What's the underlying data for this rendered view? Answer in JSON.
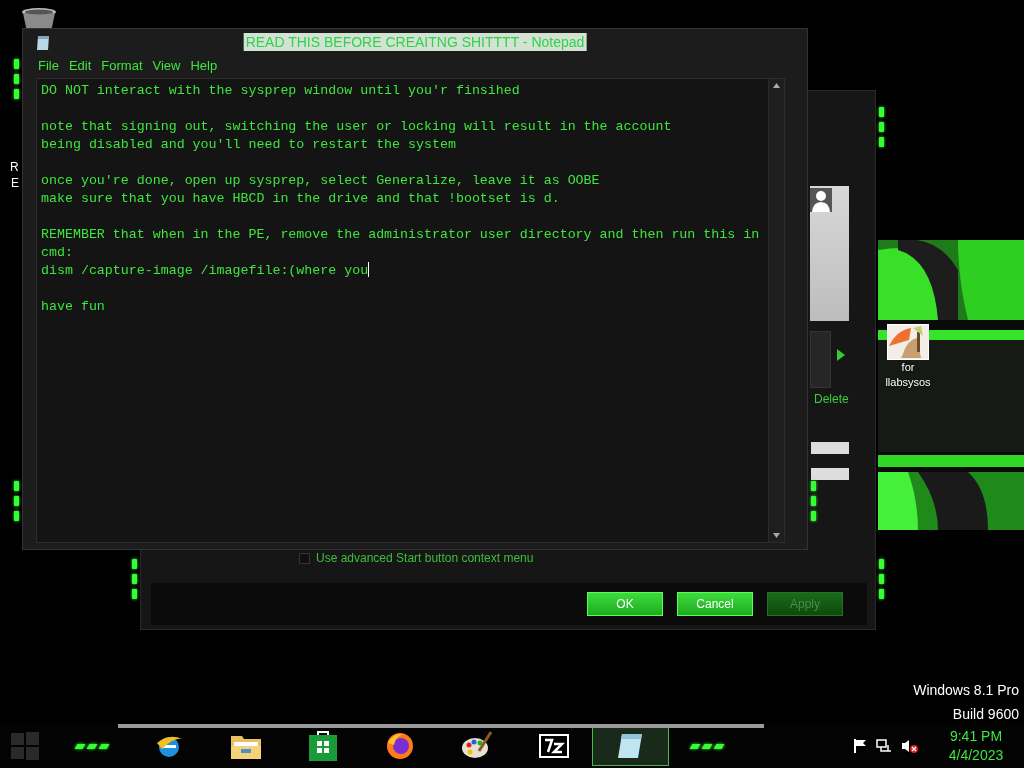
{
  "desktop": {
    "edge_letters": [
      "R",
      "E"
    ],
    "icons": [
      {
        "label_lines": [
          "for",
          "llabsysos"
        ]
      }
    ],
    "watermark": [
      "Windows 8.1 Pro",
      "Build 9600"
    ]
  },
  "properties_dialog": {
    "link": "Delete",
    "checkbox": {
      "label": "Use advanced Start button context menu",
      "checked": false
    },
    "buttons": [
      {
        "label": "OK",
        "disabled": false
      },
      {
        "label": "Cancel",
        "disabled": false
      },
      {
        "label": "Apply",
        "disabled": true
      }
    ]
  },
  "notepad": {
    "title": "READ THIS BEFORE CREAITNG SHITTTT - Notepad",
    "menu": [
      "File",
      "Edit",
      "Format",
      "View",
      "Help"
    ],
    "paragraphs": [
      [
        "DO NOT interact with the sysprep window until you'r finsihed"
      ],
      [
        "note that signing out, switching the user or locking will result in the account",
        "being disabled and you'll need to restart the system"
      ],
      [
        "once you're done, open up sysprep, select Generalize, leave it as OOBE",
        "make sure that you have HBCD in the drive and that !bootset is d."
      ],
      [
        "REMEMBER that when in the PE, remove the administrator user directory and then run this in",
        "cmd:",
        "dism /capture-image /imagefile:(where you"
      ],
      [
        "have fun"
      ]
    ]
  },
  "taskbar": {
    "apps": [
      {
        "kind": "globe",
        "selected": false
      },
      {
        "kind": "folder",
        "selected": false
      },
      {
        "kind": "store",
        "selected": false
      },
      {
        "kind": "browser",
        "selected": false
      },
      {
        "kind": "palette",
        "selected": false
      },
      {
        "kind": "archive",
        "selected": false
      },
      {
        "kind": "notepad",
        "selected": true
      }
    ],
    "time": "9:41 PM",
    "date": "4/4/2023"
  }
}
